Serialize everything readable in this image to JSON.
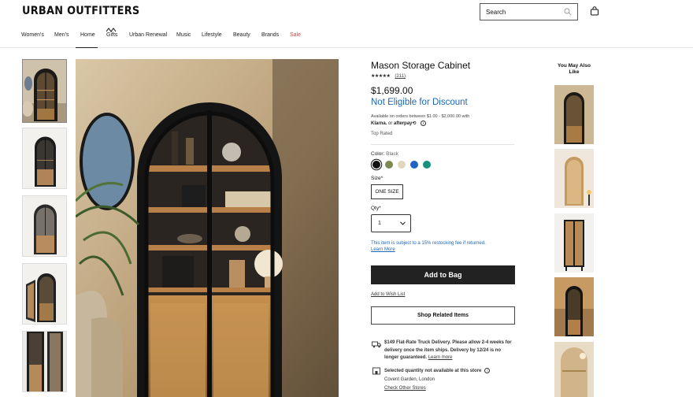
{
  "header": {
    "logo": "URBAN OUTFITTERS",
    "search_placeholder": "Search"
  },
  "nav": {
    "items": [
      {
        "label": "Women's"
      },
      {
        "label": "Men's"
      },
      {
        "label": "Home"
      },
      {
        "label": "Gifts"
      },
      {
        "label": "Urban Renewal"
      },
      {
        "label": "Music"
      },
      {
        "label": "Lifestyle"
      },
      {
        "label": "Beauty"
      },
      {
        "label": "Brands"
      },
      {
        "label": "Sale"
      }
    ],
    "active": "Home"
  },
  "product": {
    "title": "Mason Storage Cabinet",
    "stars": "★★★★★",
    "rating": 4.5,
    "review_count": "(211)",
    "price": "$1,699.00",
    "discount_note": "Not Eligible for Discount",
    "afford_text": "Available on orders between $1.00 - $2,000.00 with",
    "klarna": "Klarna.",
    "or": "or",
    "afterpay": "afterpay⟲",
    "badge": "Top Rated",
    "color_label": "Color:",
    "color_value": "Black",
    "swatches": [
      {
        "name": "Black",
        "hex": "#111111"
      },
      {
        "name": "Olive",
        "hex": "#7c8a52"
      },
      {
        "name": "Natural",
        "hex": "#e3d6bf"
      },
      {
        "name": "Blue",
        "hex": "#1f63c4"
      },
      {
        "name": "Teal",
        "hex": "#16917b"
      }
    ],
    "size_label": "Size*",
    "size_value": "ONE SIZE",
    "qty_label": "Qty*",
    "qty_value": "1",
    "restock_note": "This item is subject to a 15% restocking fee if returned.",
    "learn_more": "Learn More",
    "add_to_bag": "Add to Bag",
    "wishlist": "Add to Wish List",
    "shop_related": "Shop Related Items",
    "shipping_text": "$149 Flat-Rate Truck Delivery. Please allow 2-4 weeks for delivery once the item ships. Delivery by 12/24 is no longer guaranteed.",
    "shipping_learn_more": "Learn more",
    "store_status": "Selected quantity not available at this store",
    "store_name": "Covent Garden, London",
    "check_other": "Check Other Stores"
  },
  "recommendations": {
    "title": "You May Also Like"
  }
}
